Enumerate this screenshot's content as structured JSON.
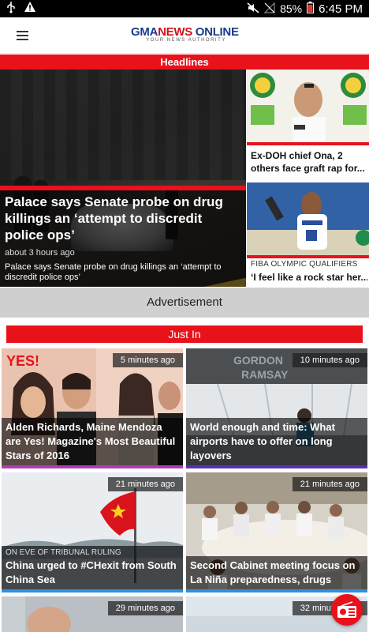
{
  "status_bar": {
    "battery": "85%",
    "time": "6:45 PM",
    "icons": [
      "usb-icon",
      "warning-icon",
      "mute-icon",
      "no-signal-icon",
      "battery-icon"
    ]
  },
  "app_bar": {
    "logo_gma": "GMA",
    "logo_news": "NEWS",
    "logo_online": "ONLINE",
    "logo_tagline": "YOUR NEWS AUTHORITY"
  },
  "headlines": {
    "label": "Headlines",
    "main": {
      "title": "Palace says Senate probe on drug killings an ‘attempt to discredit police ops’",
      "time": "about 3 hours ago",
      "summary": "Palace says Senate probe on drug killings an ‘attempt to discredit police ops’"
    },
    "side": [
      {
        "title": "Ex-DOH chief Ona, 2 others face graft rap for..."
      },
      {
        "kicker": "FIBA OLYMPIC QUALIFIERS",
        "title": "‘I feel like a rock star her..."
      }
    ]
  },
  "advertisement": {
    "label": "Advertisement"
  },
  "just_in": {
    "label": "Just In",
    "cards": [
      {
        "time": "5 minutes ago",
        "kicker": "",
        "title": "Alden Richards, Maine Mendoza are Yes! Magazine's Most Beautiful Stars of 2016",
        "bar_color": "#b13ab8"
      },
      {
        "time": "10 minutes ago",
        "kicker": "",
        "title": "World enough and time: What airports have to offer on long layovers",
        "bar_color": "#5a2fb8"
      },
      {
        "time": "21 minutes ago",
        "kicker": "ON EVE OF TRIBUNAL RULING",
        "title": "China urged to #CHexit from South China Sea",
        "bar_color": "#2f8fe0"
      },
      {
        "time": "21 minutes ago",
        "kicker": "",
        "title": "Second Cabinet meeting focus on La Niña preparedness, drugs",
        "bar_color": "#2f8fe0"
      },
      {
        "time": "29 minutes ago",
        "kicker": "",
        "title": "",
        "bar_color": "#2f8fe0"
      },
      {
        "time": "32 minutes ago",
        "kicker": "",
        "title": "",
        "bar_color": "#2f8fe0"
      }
    ]
  },
  "colors": {
    "brand_red": "#e8121b",
    "brand_blue": "#1a3c8c"
  }
}
